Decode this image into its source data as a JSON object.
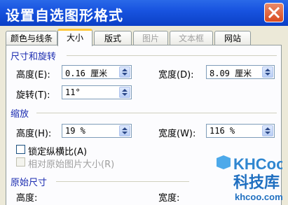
{
  "dialog": {
    "title": "设置自选图形格式"
  },
  "tabs": [
    {
      "label": "颜色与线条",
      "state": "normal"
    },
    {
      "label": "大小",
      "state": "active"
    },
    {
      "label": "版式",
      "state": "normal"
    },
    {
      "label": "图片",
      "state": "disabled"
    },
    {
      "label": "文本框",
      "state": "disabled"
    },
    {
      "label": "网站",
      "state": "normal"
    }
  ],
  "size_rotate": {
    "heading": "尺寸和旋转",
    "height_label": "高度(E):",
    "height_value": "0.16 厘米",
    "width_label": "宽度(D):",
    "width_value": "8.09 厘米",
    "rotate_label": "旋转(T):",
    "rotate_value": "11°"
  },
  "scale": {
    "heading": "缩放",
    "height_label": "高度(H):",
    "height_value": "19 %",
    "width_label": "宽度(W):",
    "width_value": "116 %",
    "lock_ratio_label": "锁定纵横比(A)",
    "relative_label": "相对原始图片大小(R)"
  },
  "original": {
    "heading": "原始尺寸",
    "height_label": "高度:",
    "width_label": "宽度:"
  },
  "watermark": {
    "logo_text": "KHCoo",
    "site_cn": "科技库",
    "site_url": "khcoo.com"
  }
}
